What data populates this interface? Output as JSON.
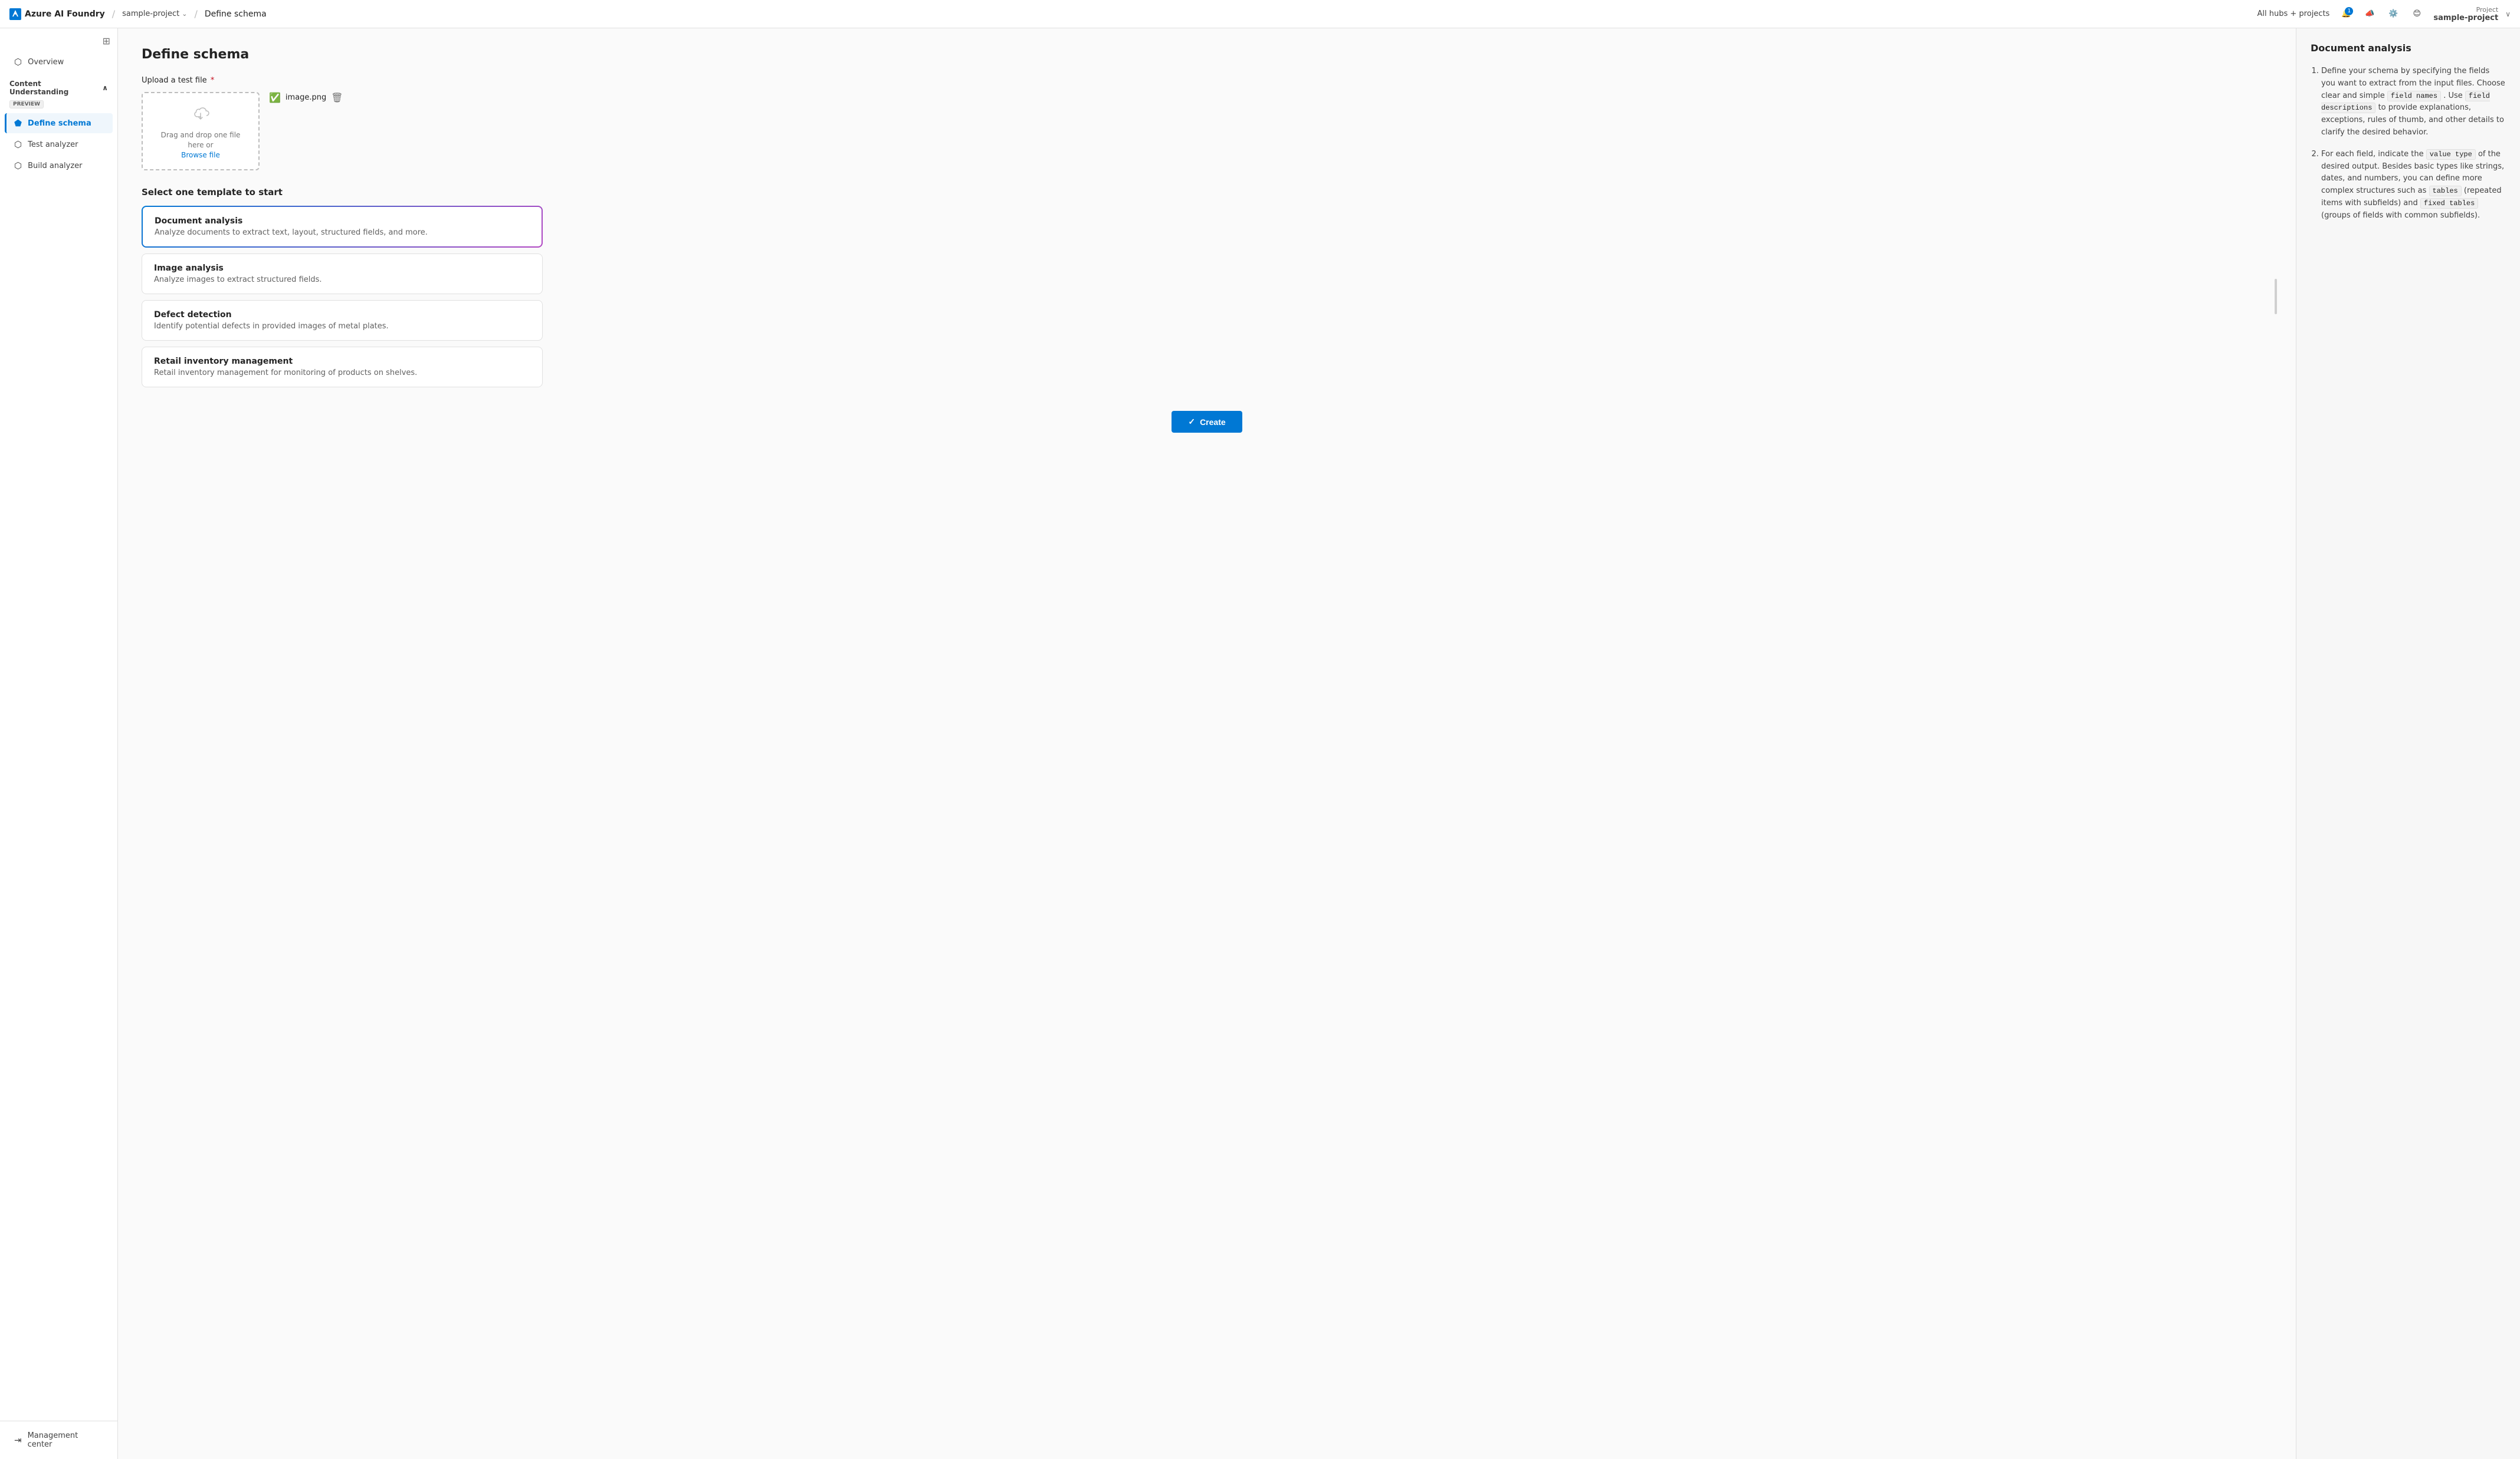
{
  "topbar": {
    "brand": "Azure AI Foundry",
    "separator": "/",
    "project_name": "sample-project",
    "page_title": "Define schema",
    "all_hubs": "All hubs + projects",
    "notification_count": "1",
    "project_label": "Project",
    "project_display": "sample-project"
  },
  "sidebar": {
    "toggle_icon": "⊞",
    "overview_label": "Overview",
    "section_label": "Content Understanding",
    "section_badge": "PREVIEW",
    "items": [
      {
        "id": "define-schema",
        "label": "Define schema",
        "active": true
      },
      {
        "id": "test-analyzer",
        "label": "Test analyzer",
        "active": false
      },
      {
        "id": "build-analyzer",
        "label": "Build analyzer",
        "active": false
      }
    ],
    "management_center": "Management center"
  },
  "main": {
    "page_title": "Define schema",
    "upload_label": "Upload a test file",
    "upload_drop_text": "Drag and drop one file here or",
    "upload_browse_text": "Browse file",
    "uploaded_file": "image.png",
    "templates_title": "Select one template to start",
    "templates": [
      {
        "id": "document-analysis",
        "name": "Document analysis",
        "desc": "Analyze documents to extract text, layout, structured fields, and more.",
        "selected": true
      },
      {
        "id": "image-analysis",
        "name": "Image analysis",
        "desc": "Analyze images to extract structured fields.",
        "selected": false
      },
      {
        "id": "defect-detection",
        "name": "Defect detection",
        "desc": "Identify potential defects in provided images of metal plates.",
        "selected": false
      },
      {
        "id": "retail-inventory",
        "name": "Retail inventory management",
        "desc": "Retail inventory management for monitoring of products on shelves.",
        "selected": false
      }
    ],
    "create_button": "Create"
  },
  "right_panel": {
    "title": "Document analysis",
    "items": [
      {
        "text_before": "Define your schema by specifying the fields you want to extract from the input files. Choose clear and simple ",
        "code1": "field names",
        "text_middle": ". Use ",
        "code2": "field descriptions",
        "text_after": " to provide explanations, exceptions, rules of thumb, and other details to clarify the desired behavior."
      },
      {
        "text_before": "For each field, indicate the ",
        "code1": "value type",
        "text_middle": " of the desired output. Besides basic types like strings, dates, and numbers, you can define more complex structures such as ",
        "code2": "tables",
        "text_middle2": " (repeated items with subfields) and ",
        "code3": "fixed tables",
        "text_after": " (groups of fields with common subfields)."
      }
    ]
  }
}
